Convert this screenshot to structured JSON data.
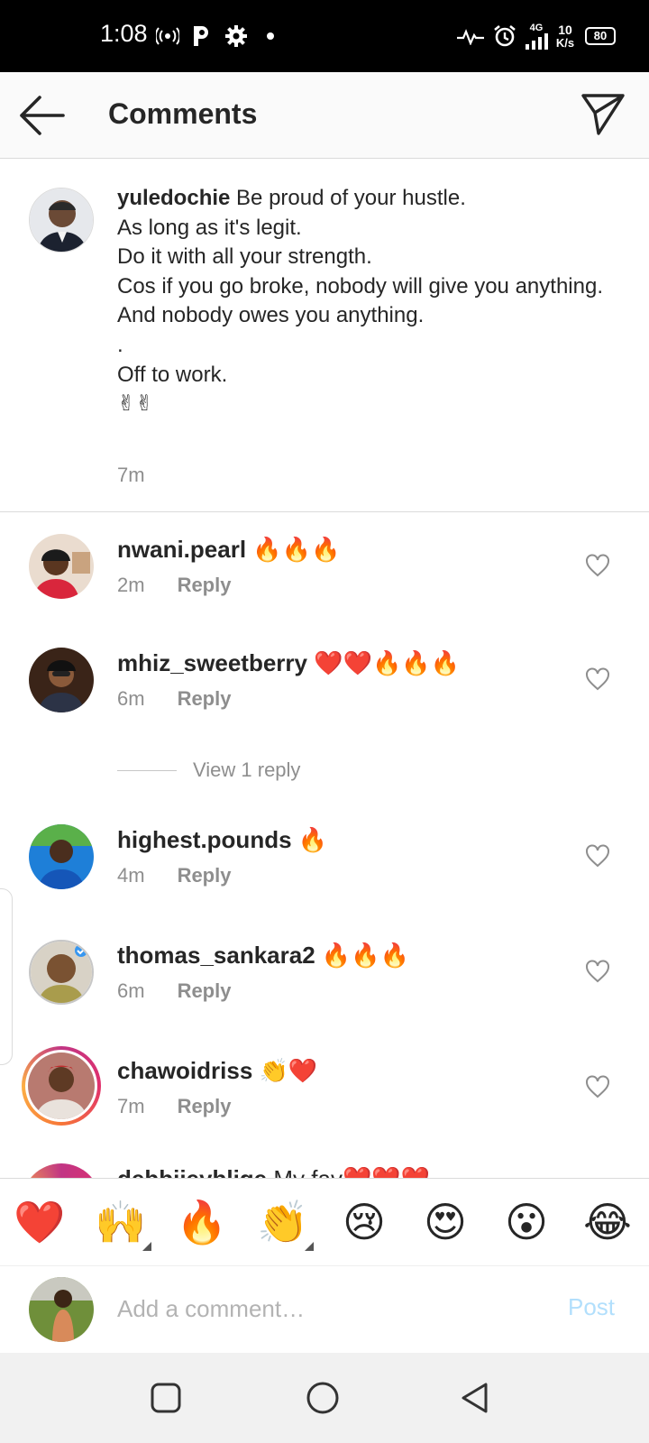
{
  "status_bar": {
    "time": "1:08",
    "network": "4G",
    "speed_value": "10",
    "speed_unit": "K/s",
    "battery": "80"
  },
  "header": {
    "title": "Comments"
  },
  "caption": {
    "username": "yuledochie",
    "text": "Be proud of your hustle.\nAs long as it's legit.\nDo it with all your strength.\nCos if you go broke, nobody will give you anything.\nAnd nobody owes you anything.\n.\nOff to work.\n✌✌",
    "time": "7m"
  },
  "comments": [
    {
      "username": "nwani.pearl",
      "text": "🔥🔥🔥",
      "time": "2m",
      "reply_label": "Reply"
    },
    {
      "username": "mhiz_sweetberry",
      "text": "❤️❤️🔥🔥🔥",
      "time": "6m",
      "reply_label": "Reply"
    },
    {
      "username": "highest.pounds",
      "text": "🔥",
      "time": "4m",
      "reply_label": "Reply"
    },
    {
      "username": "thomas_sankara2",
      "text": "🔥🔥🔥",
      "time": "6m",
      "reply_label": "Reply"
    },
    {
      "username": "chawoidriss",
      "text": "👏❤️",
      "time": "7m",
      "reply_label": "Reply"
    },
    {
      "username": "debbiieyblige",
      "text": "My fav❤️❤️❤️"
    }
  ],
  "view_replies": "View 1 reply",
  "emoji_bar": [
    "❤️",
    "🙌",
    "🔥",
    "👏",
    "😢",
    "😍",
    "😮",
    "😂"
  ],
  "comment_input": {
    "placeholder": "Add a comment…",
    "post_label": "Post"
  },
  "colors": {
    "text": "#262626",
    "muted": "#8e8e8e",
    "post_disabled": "#b2dffc",
    "story_ring": "#c13584"
  }
}
